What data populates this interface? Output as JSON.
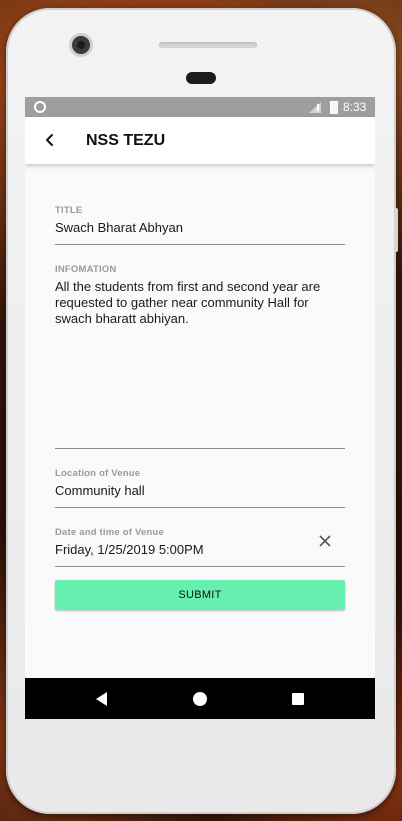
{
  "status_bar": {
    "time": "8:33"
  },
  "app_bar": {
    "title": "NSS TEZU"
  },
  "form": {
    "title_label": "TITLE",
    "title_value": "Swach Bharat Abhyan",
    "info_label": "INFOMATION",
    "info_value": "All the students from first and second year are requested to gather near community Hall for swach bharatt abhiyan.",
    "venue_label": "Location of Venue",
    "venue_value": "Community hall",
    "datetime_label": "Date and time of Venue",
    "datetime_value": "Friday, 1/25/2019  5:00PM",
    "submit_label": "SUBMIT"
  },
  "icons": {
    "back": "back-arrow-icon",
    "clear": "close-icon",
    "nav_back": "nav-back-icon",
    "nav_home": "nav-home-icon",
    "nav_recent": "nav-recent-icon"
  },
  "colors": {
    "submit_button": "#66f0b0",
    "status_bar": "#9e9e9e",
    "nav_bar": "#000000"
  }
}
